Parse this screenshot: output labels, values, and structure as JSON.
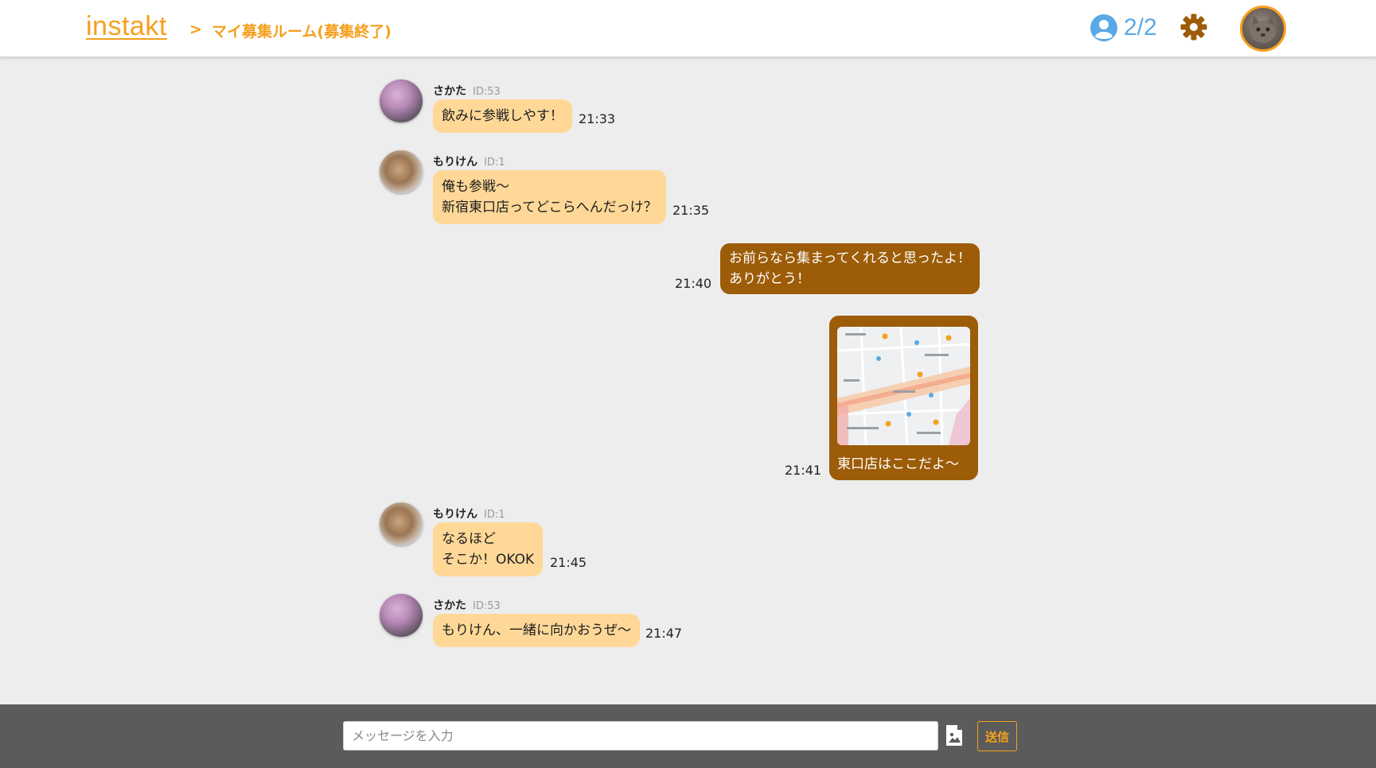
{
  "header": {
    "logo": "instakt",
    "separator": ">",
    "breadcrumb": "マイ募集ルーム(募集終了)",
    "member_count": "2/2"
  },
  "messages": [
    {
      "sender": "さかた",
      "id": "ID:53",
      "lines": [
        "飲みに参戦しやす！"
      ],
      "time": "21:33"
    },
    {
      "sender": "もりけん",
      "id": "ID:1",
      "lines": [
        "俺も参戦〜",
        "新宿東口店ってどこらへんだっけ？"
      ],
      "time": "21:35"
    },
    {
      "mine": true,
      "lines": [
        "お前らなら集まってくれると思ったよ！",
        "ありがとう！"
      ],
      "time": "21:40"
    },
    {
      "mine": true,
      "type": "image",
      "caption": "東口店はここだよ〜",
      "time": "21:41"
    },
    {
      "sender": "もりけん",
      "id": "ID:1",
      "lines": [
        "なるほど",
        "そこか！OKOK"
      ],
      "time": "21:45"
    },
    {
      "sender": "さかた",
      "id": "ID:53",
      "lines": [
        "もりけん、一緒に向かおうぜ〜"
      ],
      "time": "21:47"
    }
  ],
  "composer": {
    "placeholder": "メッセージを入力",
    "send_label": "送信"
  },
  "colors": {
    "accent": "#f5a01e",
    "incoming_bubble": "#ffd898",
    "outgoing_bubble": "#9c5c08",
    "member_icon": "#5aa9e6",
    "gear": "#9c5c08",
    "footer": "#5b5b5b"
  },
  "icons": [
    "user-circle-icon",
    "gear-icon",
    "image-attach-icon"
  ]
}
